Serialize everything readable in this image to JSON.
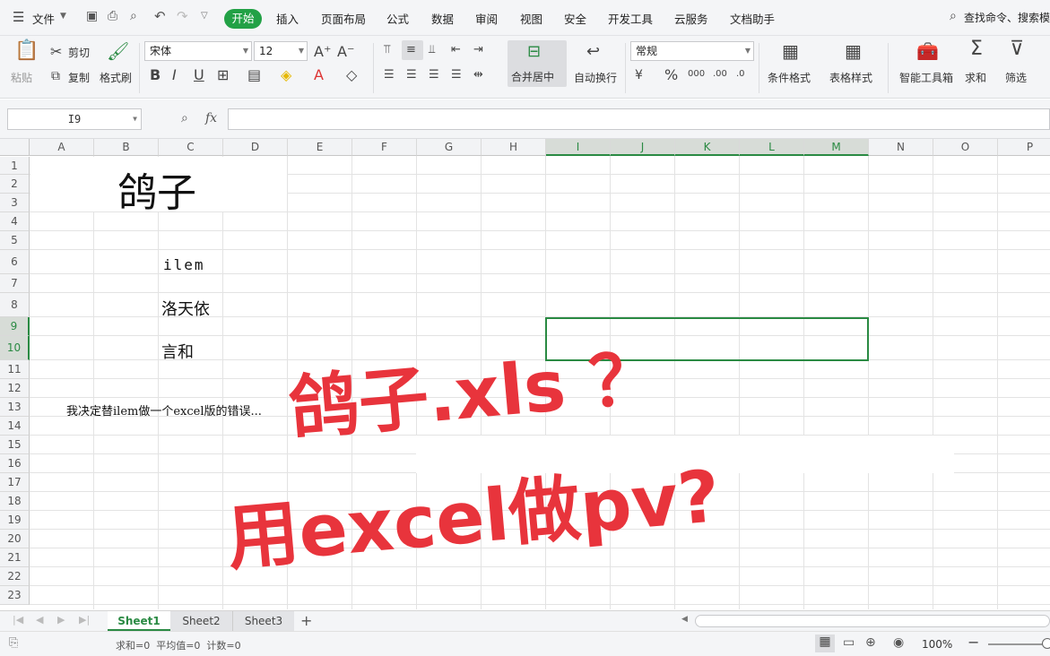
{
  "menu": {
    "file": "文件",
    "items": [
      "开始",
      "插入",
      "页面布局",
      "公式",
      "数据",
      "审阅",
      "视图",
      "安全",
      "开发工具",
      "云服务",
      "文档助手"
    ],
    "search": "查找命令、搜索模"
  },
  "ribbon": {
    "paste": "粘贴",
    "cut": "剪切",
    "copy": "复制",
    "format_painter": "格式刷",
    "font_name": "宋体",
    "font_size": "12",
    "number_format": "常规",
    "merge_center": "合并居中",
    "wrap_text": "自动换行",
    "conditional_format": "条件格式",
    "table_style": "表格样式",
    "smart_toolbox": "智能工具箱",
    "sum": "求和",
    "filter": "筛选"
  },
  "formula_bar": {
    "name_box": "I9",
    "fx": "fx",
    "value": ""
  },
  "columns": [
    "A",
    "B",
    "C",
    "D",
    "E",
    "F",
    "G",
    "H",
    "I",
    "J",
    "K",
    "L",
    "M",
    "N",
    "O",
    "P"
  ],
  "rows": [
    "1",
    "2",
    "3",
    "4",
    "5",
    "6",
    "7",
    "8",
    "9",
    "10",
    "11",
    "12",
    "13",
    "14",
    "15",
    "16",
    "17",
    "18",
    "19",
    "20",
    "21",
    "22",
    "23"
  ],
  "cells": {
    "title": "鸽子",
    "c6": "ilem",
    "c8": "洛天依",
    "c10": "言和",
    "a13": "我决定替ilem做一个excel版的错误..."
  },
  "overlay": {
    "line1": "鸽子.xls ？",
    "line2": "用excel做pv?"
  },
  "sheets": [
    "Sheet1",
    "Sheet2",
    "Sheet3"
  ],
  "status": {
    "summary": "求和=0  平均值=0  计数=0",
    "zoom": "100%"
  },
  "colors": {
    "accent_green": "#22a146",
    "overlay_red": "#e8343c"
  }
}
